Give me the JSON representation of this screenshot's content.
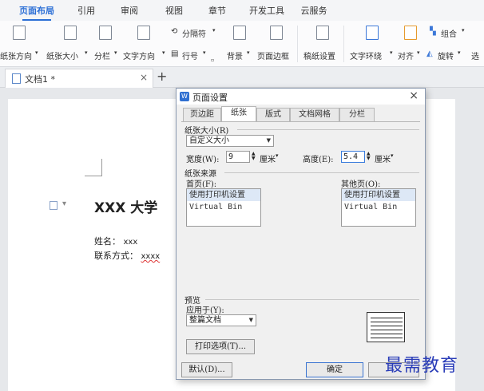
{
  "ribbon": {
    "tabs": [
      "页面布局",
      "引用",
      "审阅",
      "视图",
      "章节",
      "开发工具",
      "云服务"
    ],
    "active_tab": "页面布局"
  },
  "toolbar": {
    "row1": {
      "separator": "分隔符",
      "group": "组合"
    },
    "row2": {
      "orientation": "纸张方向",
      "size": "纸张大小",
      "columns": "分栏",
      "text_direction": "文字方向",
      "line_number": "行号",
      "background": "背景",
      "page_border": "页面边框",
      "manuscript": "稿纸设置",
      "text_wrap": "文字环绕",
      "align": "对齐",
      "rotate": "旋转",
      "select": "选"
    },
    "accent_color": "#3c78d8"
  },
  "doc_tabs": {
    "tab_label": "文档1 *",
    "close": "×",
    "new": "+"
  },
  "document": {
    "heading": "XXX 大学",
    "name_label": "姓名：",
    "name_value": "xxx",
    "contact_label": "联系方式：",
    "contact_value": "xxxx"
  },
  "dialog": {
    "title": "页面设置",
    "close": "×",
    "tabs": [
      "页边距",
      "纸张",
      "版式",
      "文档网格",
      "分栏"
    ],
    "active_tab": "纸张",
    "paper_size": {
      "label": "纸张大小(R)",
      "value": "自定义大小",
      "width_label": "宽度(W):",
      "width_value": "9",
      "width_unit": "厘米",
      "height_label": "高度(E):",
      "height_value": "5.4",
      "height_unit": "厘米"
    },
    "paper_source": {
      "label": "纸张来源",
      "first_page_label": "首页(F):",
      "first_page_items": [
        "使用打印机设置",
        "Virtual Bin"
      ],
      "other_pages_label": "其他页(O):",
      "other_pages_items": [
        "使用打印机设置",
        "Virtual Bin"
      ]
    },
    "preview": {
      "label": "预览",
      "apply_label": "应用于(Y):",
      "apply_value": "整篇文档"
    },
    "print_options": "打印选项(T)...",
    "default_button": "默认(D)...",
    "ok_button": "确定"
  },
  "watermark": "最需教育"
}
